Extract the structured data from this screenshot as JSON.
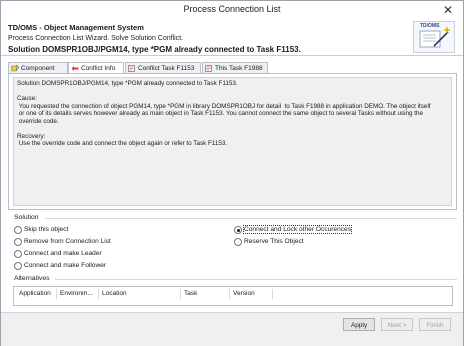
{
  "window": {
    "title": "Process Connection List"
  },
  "header": {
    "app_title": "TD/OMS - Object Management System",
    "wizard_line": "Process Connection List Wizard. Solve Solution Conflict.",
    "solution_line": "Solution DOMSPR1OBJ/PGM14, type *PGM already connected to Task F1153.",
    "logo_text": "TD/OMS"
  },
  "tabs": [
    {
      "label": "Component Info",
      "icon": "component-icon"
    },
    {
      "label": "Conflict Info",
      "icon": "conflict-icon"
    },
    {
      "label": "Conflict Task F1153",
      "icon": "task-icon"
    },
    {
      "label": "This Task F1988",
      "icon": "task-icon"
    }
  ],
  "active_tab": "Conflict Info",
  "conflict_text": "Solution DOMSPR1OBJ/PGM14, type *PGM already connected to Task F1153.\n\nCause:\n You requested the connection of object PGM14, type *PGM in library DOMSPR1OBJ for detail  to Task F1988 in application DEMO. The object itself\n or one of its details serves however already as main object in Task F1153. You cannot connect the same object to several Tasks without using the\n override code.\n\nRecovery:\n Use the override code and connect the object again or refer to Task F1153.",
  "solution": {
    "title": "Solution",
    "options": [
      {
        "label": "Skip this object",
        "selected": false
      },
      {
        "label": "Remove from Connection List",
        "selected": false
      },
      {
        "label": "Connect and make Leader",
        "selected": false
      },
      {
        "label": "Connect and make Follower",
        "selected": false
      },
      {
        "label": "Connect and Lock other Occurences",
        "selected": true
      },
      {
        "label": "Reserve This Object",
        "selected": false
      }
    ]
  },
  "alternatives": {
    "title": "Alternatives",
    "columns": [
      "Application",
      "Environm...",
      "Location",
      "Task",
      "Version"
    ]
  },
  "buttons": {
    "apply": "Apply",
    "next": "Next >",
    "finish": "Finish"
  },
  "colors": {
    "tab_warning": "#d23a2a",
    "border": "#b8bfc8",
    "textarea_bg": "#f0f0f0"
  }
}
